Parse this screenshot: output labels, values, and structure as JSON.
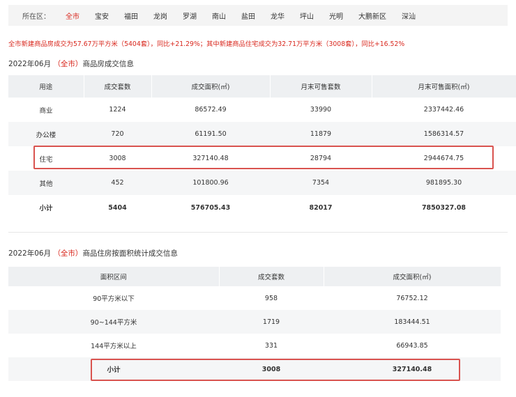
{
  "filter": {
    "label": "所在区：",
    "districts": [
      "全市",
      "宝安",
      "福田",
      "龙岗",
      "罗湖",
      "南山",
      "盐田",
      "龙华",
      "坪山",
      "光明",
      "大鹏新区",
      "深汕"
    ],
    "active_index": 0
  },
  "summary": "全市新建商品房成交为57.67万平方米（5404套），同比+21.29%；其中新建商品住宅成交为32.71万平方米（3008套），同比+16.52%",
  "section1": {
    "date": "2022年06月",
    "scope": "（全市）",
    "title": "商品房成交信息",
    "headers": [
      "用途",
      "成交套数",
      "成交面积(㎡)",
      "月末可售套数",
      "月末可售面积(㎡)"
    ],
    "rows": [
      [
        "商业",
        "1224",
        "86572.49",
        "33990",
        "2337442.46"
      ],
      [
        "办公楼",
        "720",
        "61191.50",
        "11879",
        "1586314.57"
      ],
      [
        "住宅",
        "3008",
        "327140.48",
        "28794",
        "2944674.75"
      ],
      [
        "其他",
        "452",
        "101800.96",
        "7354",
        "981895.30"
      ],
      [
        "小计",
        "5404",
        "576705.43",
        "82017",
        "7850327.08"
      ]
    ]
  },
  "section2": {
    "date": "2022年06月",
    "scope": "（全市）",
    "title": "商品住房按面积统计成交信息",
    "headers": [
      "面积区间",
      "成交套数",
      "成交面积(㎡)"
    ],
    "rows": [
      [
        "90平方米以下",
        "958",
        "76752.12"
      ],
      [
        "90~144平方米",
        "1719",
        "183444.51"
      ],
      [
        "144平方米以上",
        "331",
        "66943.85"
      ],
      [
        "小计",
        "3008",
        "327140.48"
      ]
    ]
  },
  "colors": {
    "accent": "#d9281e",
    "highlight": "#d9534f",
    "header_bg": "#eef0f2"
  }
}
